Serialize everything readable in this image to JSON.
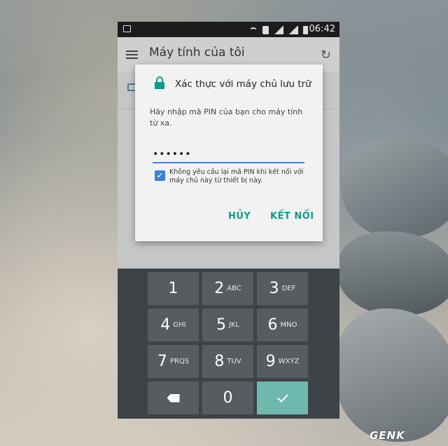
{
  "status_bar": {
    "time": "06:42"
  },
  "app_bar": {
    "title": "Máy tính của tôi"
  },
  "dialog": {
    "title": "Xác thực với máy chủ lưu trữ",
    "message": "Hãy nhập mã PIN của bạn cho máy tính từ xa.",
    "pin_value": "••••••",
    "checkbox_checked": true,
    "checkbox_label": "Không yêu cầu lại mã PIN khi kết nối với máy chủ này từ thiết bị này.",
    "cancel_label": "HỦY",
    "connect_label": "KẾT NỐI"
  },
  "keypad": {
    "keys": [
      {
        "num": "1",
        "letters": ""
      },
      {
        "num": "2",
        "letters": "ABC"
      },
      {
        "num": "3",
        "letters": "DEF"
      },
      {
        "num": "4",
        "letters": "GHI"
      },
      {
        "num": "5",
        "letters": "JKL"
      },
      {
        "num": "6",
        "letters": "MNO"
      },
      {
        "num": "7",
        "letters": "PRQS"
      },
      {
        "num": "8",
        "letters": "TUV"
      },
      {
        "num": "9",
        "letters": "WXYZ"
      },
      {
        "num": "0",
        "letters": ""
      }
    ]
  },
  "watermark": "GENK"
}
